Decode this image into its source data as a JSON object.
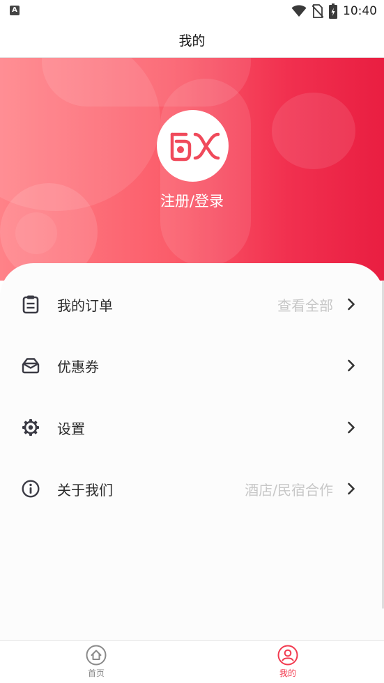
{
  "status_bar": {
    "time": "10:40",
    "notification_glyph": "A"
  },
  "header": {
    "title": "我的"
  },
  "profile": {
    "logo_text": "FX",
    "login_label": "注册/登录"
  },
  "menu": [
    {
      "label": "我的订单",
      "hint": "查看全部",
      "icon": "clipboard-icon"
    },
    {
      "label": "优惠券",
      "hint": "",
      "icon": "envelope-icon"
    },
    {
      "label": "设置",
      "hint": "",
      "icon": "gear-icon"
    },
    {
      "label": "关于我们",
      "hint": "酒店/民宿合作",
      "icon": "info-icon"
    }
  ],
  "bottom_nav": [
    {
      "label": "首页",
      "icon": "home-icon",
      "active": false
    },
    {
      "label": "我的",
      "icon": "user-icon",
      "active": true
    }
  ],
  "colors": {
    "accent": "#f23a4f",
    "nav_inactive": "#8a8a8a",
    "hint": "#c7c7c7"
  }
}
